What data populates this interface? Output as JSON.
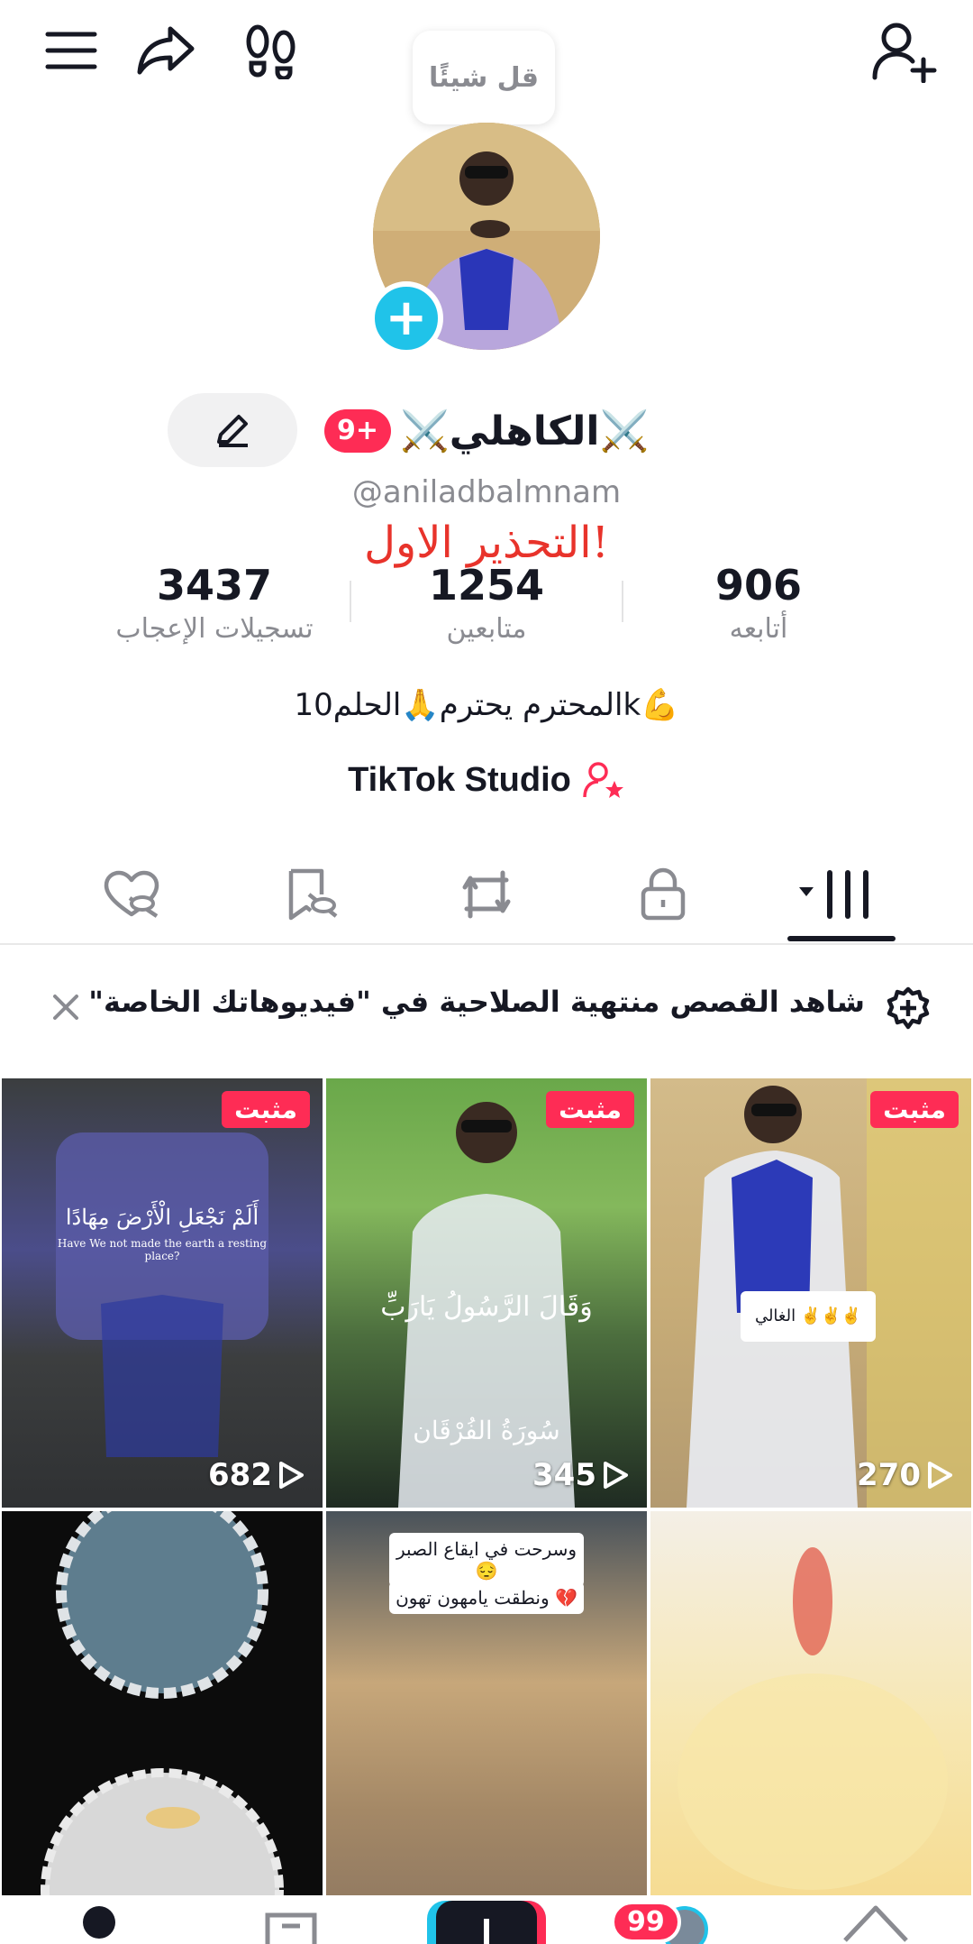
{
  "header": {
    "menu_icon": "hamburger-menu-icon",
    "share_icon": "share-arrow-icon",
    "footprint_icon": "footprints-icon",
    "add_friend_icon": "add-user-icon"
  },
  "speech_bubble": {
    "text": "قل شيئًا"
  },
  "profile": {
    "display_name": "⚔️الكاهلي⚔️",
    "notification_badge": "9+",
    "username": "@aniladbalmnam",
    "warning": "التحذير الاول!",
    "bio": "المحترم يحترم🙏الحلم10k💪",
    "studio_label": "TikTok Studio"
  },
  "stats": {
    "likes": {
      "value": "3437",
      "label": "تسجيلات الإعجاب"
    },
    "followers": {
      "value": "1254",
      "label": "متابعين"
    },
    "following": {
      "value": "906",
      "label": "أتابعه"
    }
  },
  "tabs": {
    "liked_icon": "heart-hidden-icon",
    "saved_icon": "bookmark-hidden-icon",
    "reposts_icon": "repost-icon",
    "private_icon": "lock-icon",
    "videos_icon": "grid-videos-icon"
  },
  "banner": {
    "text": "شاهد القصص منتهية الصلاحية في \"فيديوهاتك الخاصة\""
  },
  "videos": [
    {
      "pinned": "مثبت",
      "views": "682",
      "caption": "أَلَمْ نَجْعَلِ الْأَرْضَ مِهَادًا",
      "caption_en": "Have We not made the earth a resting place?"
    },
    {
      "pinned": "مثبت",
      "views": "345",
      "caption": "وَقَالَ الرَّسُولُ يَارَبِّ",
      "caption2": "سُورَةُ الفُرْقَان"
    },
    {
      "pinned": "مثبت",
      "views": "270",
      "caption": "الغالي ✌️✌️✌️"
    },
    {
      "views": ""
    },
    {
      "views": "",
      "caption": "وسرحت في ايقاع الصبر 😔",
      "caption2": "ونطقت يامهون تهون 💔"
    },
    {
      "views": ""
    }
  ],
  "bottom_nav": {
    "badge": "99"
  },
  "colors": {
    "accent": "#fe2c55",
    "cyan": "#20c3e9",
    "warning": "#e8332b"
  }
}
